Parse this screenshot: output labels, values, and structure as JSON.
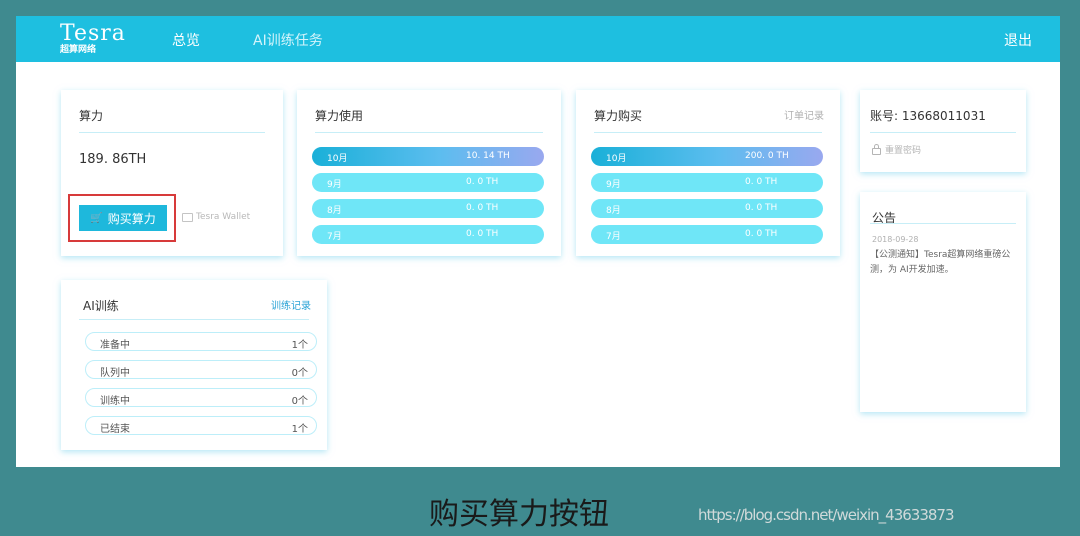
{
  "header": {
    "logo_text": "Tesra",
    "logo_subtitle": "超算网络",
    "nav": [
      {
        "label": "总览"
      },
      {
        "label": "AI训练任务"
      }
    ],
    "logout_label": "退出"
  },
  "hashpower": {
    "title": "算力",
    "value": "189. 86TH",
    "buy_label": "购买算力",
    "wallet_label": "Tesra Wallet"
  },
  "usage": {
    "title": "算力使用",
    "rows": [
      {
        "month": "10月",
        "value": "10. 14 TH"
      },
      {
        "month": "9月",
        "value": "0. 0 TH"
      },
      {
        "month": "8月",
        "value": "0. 0 TH"
      },
      {
        "month": "7月",
        "value": "0. 0 TH"
      }
    ]
  },
  "purchase": {
    "title": "算力购买",
    "link_label": "订单记录",
    "rows": [
      {
        "month": "10月",
        "value": "200. 0 TH"
      },
      {
        "month": "9月",
        "value": "0. 0 TH"
      },
      {
        "month": "8月",
        "value": "0. 0 TH"
      },
      {
        "month": "7月",
        "value": "0. 0 TH"
      }
    ]
  },
  "account": {
    "label": "账号: 13668011031",
    "reset_label": "重置密码"
  },
  "notice": {
    "title": "公告",
    "date": "2018-09-28",
    "text": "【公测通知】Tesra超算网络重磅公测，为 AI开发加速。"
  },
  "training": {
    "title": "AI训练",
    "link_label": "训练记录",
    "rows": [
      {
        "label": "准备中",
        "count": "1个"
      },
      {
        "label": "队列中",
        "count": "0个"
      },
      {
        "label": "训练中",
        "count": "0个"
      },
      {
        "label": "已结束",
        "count": "1个"
      }
    ]
  },
  "caption": "购买算力按钮",
  "watermark": "https://blog.csdn.net/weixin_43633873",
  "colors": {
    "header": "#1ebfe0",
    "accent_button": "#1eb8dc",
    "pill": "#6fe6f7",
    "highlight_box": "#d73a3a",
    "page_background": "#3f8a8f"
  }
}
